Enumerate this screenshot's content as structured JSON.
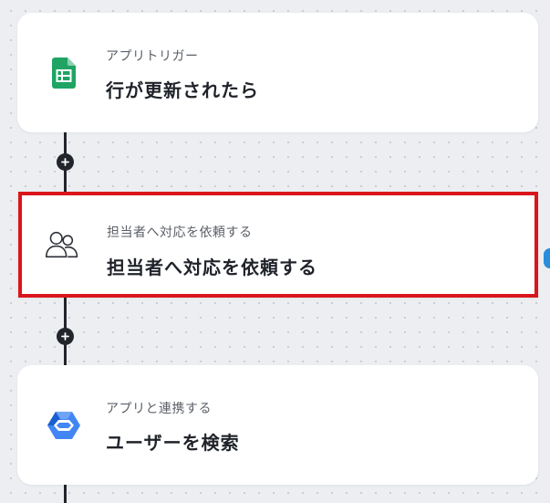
{
  "flow": {
    "steps": [
      {
        "subtitle": "アプリトリガー",
        "title": "行が更新されたら",
        "icon": "google-sheets-icon"
      },
      {
        "subtitle": "担当者へ対応を依頼する",
        "title": "担当者へ対応を依頼する",
        "icon": "users-icon"
      },
      {
        "subtitle": "アプリと連携する",
        "title": "ユーザーを検索",
        "icon": "google-workspace-icon"
      }
    ],
    "add_step_icon": "plus-icon"
  },
  "colors": {
    "highlight_border": "#d9161b",
    "connector": "#22252b",
    "sheets_green": "#1fa463",
    "workspace_blue": "#4285f4",
    "edge_marker": "#2a8cdb"
  }
}
